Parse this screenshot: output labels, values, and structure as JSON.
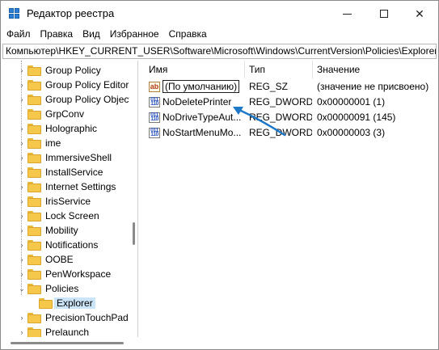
{
  "window": {
    "title": "Редактор реестра"
  },
  "menu": [
    "Файл",
    "Правка",
    "Вид",
    "Избранное",
    "Справка"
  ],
  "address": "Компьютер\\HKEY_CURRENT_USER\\Software\\Microsoft\\Windows\\CurrentVersion\\Policies\\Explorer",
  "tree": {
    "items": [
      {
        "label": "Group Policy",
        "expandable": true
      },
      {
        "label": "Group Policy Editor",
        "expandable": true
      },
      {
        "label": "Group Policy Objects",
        "expandable": true
      },
      {
        "label": "GrpConv",
        "expandable": false
      },
      {
        "label": "Holographic",
        "expandable": true
      },
      {
        "label": "ime",
        "expandable": true
      },
      {
        "label": "ImmersiveShell",
        "expandable": true
      },
      {
        "label": "InstallService",
        "expandable": true
      },
      {
        "label": "Internet Settings",
        "expandable": true
      },
      {
        "label": "IrisService",
        "expandable": true
      },
      {
        "label": "Lock Screen",
        "expandable": true
      },
      {
        "label": "Mobility",
        "expandable": true
      },
      {
        "label": "Notifications",
        "expandable": true
      },
      {
        "label": "OOBE",
        "expandable": true
      },
      {
        "label": "PenWorkspace",
        "expandable": true
      },
      {
        "label": "Policies",
        "expandable": true,
        "expanded": true
      },
      {
        "label": "Explorer",
        "expandable": false,
        "selected": true,
        "child": true
      },
      {
        "label": "PrecisionTouchPad",
        "expandable": true
      },
      {
        "label": "Prelaunch",
        "expandable": true
      }
    ]
  },
  "columns": {
    "name": "Имя",
    "type": "Тип",
    "value": "Значение"
  },
  "rows": [
    {
      "icon": "ab",
      "icon_kind": "string",
      "name": "(По умолчанию)",
      "type": "REG_SZ",
      "value": "(значение не присвоено)"
    },
    {
      "icon": "011 110",
      "icon_kind": "dword",
      "name": "NoDeletePrinter",
      "type": "REG_DWORD",
      "value": "0x00000001 (1)"
    },
    {
      "icon": "011 110",
      "icon_kind": "dword",
      "name": "NoDriveTypeAut...",
      "type": "REG_DWORD",
      "value": "0x00000091 (145)"
    },
    {
      "icon": "011 110",
      "icon_kind": "dword",
      "name": "NoStartMenuMo...",
      "type": "REG_DWORD",
      "value": "0x00000003 (3)"
    }
  ],
  "colors": {
    "selection": "#cce4f7",
    "folder": "#f5c84c",
    "arrow": "#1e78c8"
  }
}
